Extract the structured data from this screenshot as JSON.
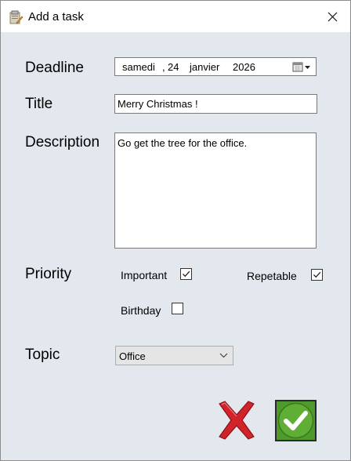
{
  "window": {
    "title": "Add a task"
  },
  "form": {
    "deadline": {
      "label": "Deadline",
      "weekday": "samedi",
      "separator": ",",
      "day": "24",
      "month": "janvier",
      "year": "2026"
    },
    "title": {
      "label": "Title",
      "value": "Merry Christmas !"
    },
    "description": {
      "label": "Description",
      "value": "Go get the tree for the office."
    },
    "priority": {
      "label": "Priority",
      "important": {
        "label": "Important",
        "checked": true
      },
      "repetable": {
        "label": "Repetable",
        "checked": true
      },
      "birthday": {
        "label": "Birthday",
        "checked": false
      }
    },
    "topic": {
      "label": "Topic",
      "selected": "Office"
    }
  },
  "icons": {
    "app": "clipboard-icon",
    "close": "close-icon",
    "calendar": "calendar-icon",
    "dropdown": "chevron-down-icon",
    "cancel": "red-x-icon",
    "confirm": "green-check-icon"
  },
  "colors": {
    "background": "#e3e8ef",
    "cancel": "#d0232a",
    "confirm": "#4f9a2c"
  }
}
